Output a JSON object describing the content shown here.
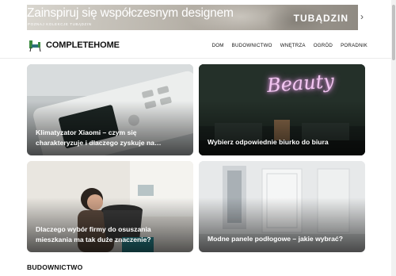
{
  "ad": {
    "headline": "Zainspiruj się współczesnym designem",
    "subline": "POZNAJ KOLEKCJE TUBĄDZIN",
    "brand": "TUBĄDZIN",
    "next_icon": "chevron-right-icon"
  },
  "header": {
    "logo_icon": "chair-icon",
    "logo_text": "COMPLETEHOME",
    "nav": [
      "DOM",
      "BUDOWNICTWO",
      "WNĘTRZA",
      "OGRÓD",
      "PORADNIK"
    ]
  },
  "cards": [
    {
      "title": "Klimatyzator Xiaomi – czym się charakteryzuje i dlaczego zyskuje na…"
    },
    {
      "title": "Wybierz odpowiednie biurko do biura",
      "neon_text": "Beauty"
    },
    {
      "title": "Dlaczego wybór firmy do osuszania mieszkania ma tak duże znaczenie?"
    },
    {
      "title": "Modne panele podłogowe – jakie wybrać?"
    }
  ],
  "section": {
    "title": "BUDOWNICTWO"
  },
  "colors": {
    "accent_neon": "#e7a6e6",
    "logo_green": "#3a8a3e",
    "text": "#111111"
  }
}
